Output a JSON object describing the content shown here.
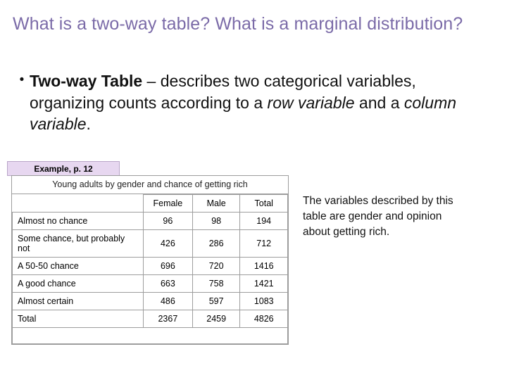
{
  "slide": {
    "title": "What is a two-way table?  What is a marginal distribution?",
    "bullets": [
      {
        "marker": "•",
        "lead": "Two-way Table",
        "rest_1": " – describes two categorical variables, organizing counts according to a ",
        "italic_1": "row variable",
        "rest_2": " and a ",
        "italic_2": "column variable",
        "rest_3": "."
      }
    ],
    "example_tag": "Example, p. 12",
    "table": {
      "caption": "Young adults by gender and chance of getting rich",
      "corner_label": "",
      "columns": [
        "Female",
        "Male",
        "Total"
      ],
      "rows": [
        {
          "label": "Almost no chance",
          "values": [
            "96",
            "98",
            "194"
          ]
        },
        {
          "label": "Some chance, but probably not",
          "values": [
            "426",
            "286",
            "712"
          ]
        },
        {
          "label": "A 50-50 chance",
          "values": [
            "696",
            "720",
            "1416"
          ]
        },
        {
          "label": "A good chance",
          "values": [
            "663",
            "758",
            "1421"
          ]
        },
        {
          "label": "Almost certain",
          "values": [
            "486",
            "597",
            "1083"
          ]
        },
        {
          "label": "Total",
          "values": [
            "2367",
            "2459",
            "4826"
          ]
        }
      ]
    },
    "side_note": "The variables described by this table are gender and opinion about getting rich."
  }
}
